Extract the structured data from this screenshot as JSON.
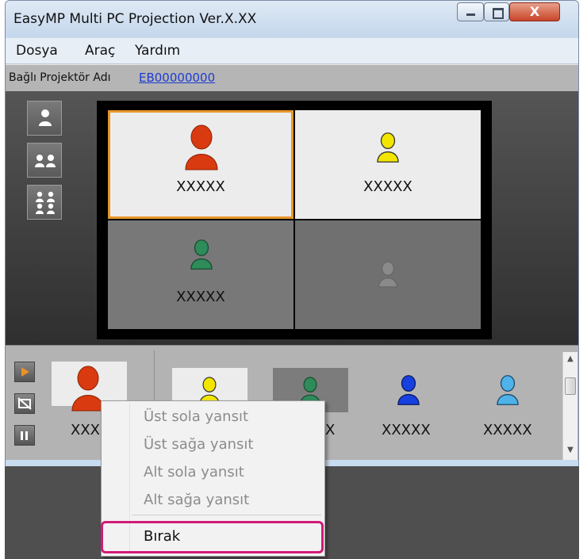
{
  "window": {
    "title": "EasyMP Multi PC Projection Ver.X.XX",
    "controls": {
      "close_glyph": "X"
    }
  },
  "menu": {
    "items": [
      "Dosya",
      "Araç",
      "Yardım"
    ]
  },
  "projector": {
    "label": "Bağlı Projektör Adı",
    "name": "EB00000000"
  },
  "layout_buttons": [
    "single-user-icon",
    "two-users-icon",
    "four-users-icon"
  ],
  "screen": {
    "cells": [
      {
        "name": "XXXXX",
        "icon": "user-icon",
        "color": "#d93a10",
        "selected": true
      },
      {
        "name": "XXXXX",
        "icon": "user-icon",
        "color": "#f2e600"
      },
      {
        "name": "XXXXX",
        "icon": "user-icon",
        "color": "#2e8b5a"
      },
      {
        "name": "",
        "icon": "user-icon",
        "color": "#8a8a8a",
        "empty": true
      }
    ]
  },
  "controls": [
    "play-icon",
    "stop-display-icon",
    "pause-icon"
  ],
  "user_list": [
    {
      "name": "XXX",
      "color": "#d93a10"
    },
    {
      "name": "",
      "color": "#f2e600"
    },
    {
      "name": "X",
      "color": "#2e8b5a"
    },
    {
      "name": "XXXXX",
      "color": "#1740e0"
    },
    {
      "name": "XXXXX",
      "color": "#4fb2e8"
    }
  ],
  "context_menu": {
    "items": [
      {
        "label": "Üst sola yansıt",
        "enabled": false
      },
      {
        "label": "Üst sağa yansıt",
        "enabled": false
      },
      {
        "label": "Alt sola yansıt",
        "enabled": false
      },
      {
        "label": "Alt sağa yansıt",
        "enabled": false
      }
    ],
    "release": {
      "label": "Bırak",
      "enabled": true
    }
  },
  "colors": {
    "highlight": "#d21a78",
    "selected_border": "#e8962a",
    "link": "#1e3cd2"
  }
}
